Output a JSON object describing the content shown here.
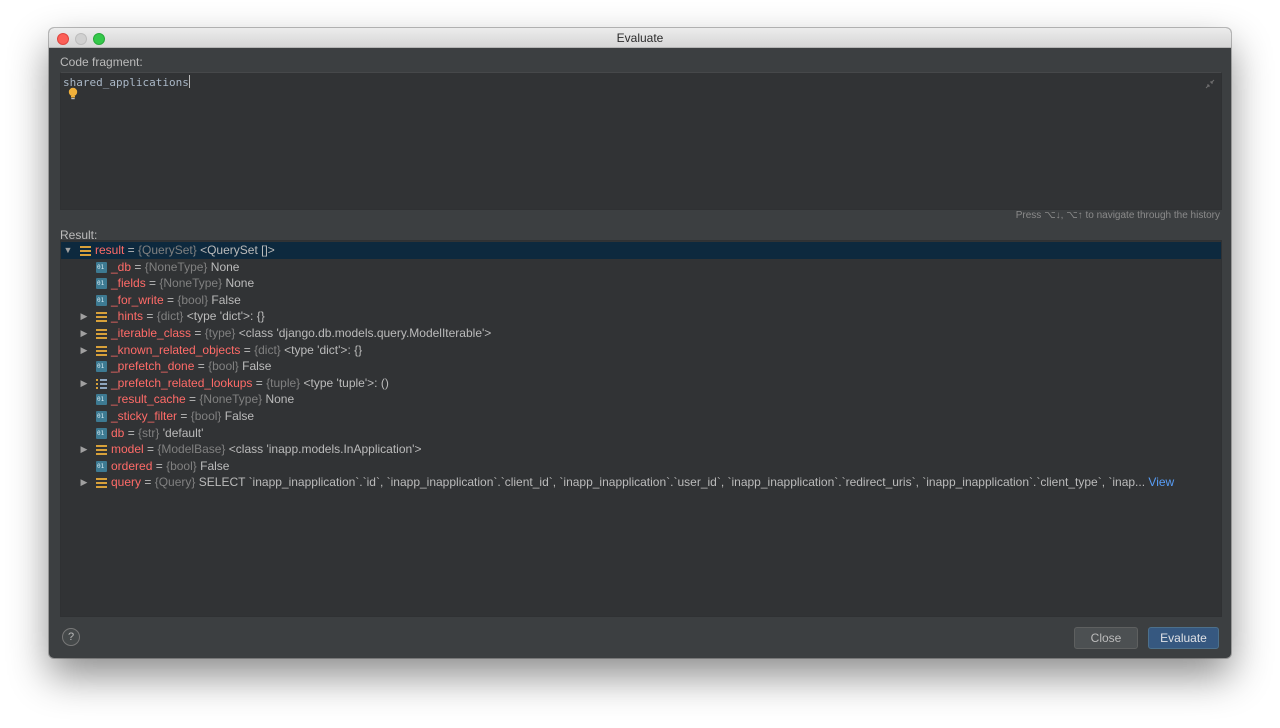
{
  "window": {
    "title": "Evaluate"
  },
  "code_fragment": {
    "label": "Code fragment:",
    "text": "shared_applications"
  },
  "history_hint": "Press ⌥↓, ⌥↑ to navigate through the history",
  "result": {
    "label": "Result:",
    "rows": [
      {
        "name": "result",
        "type": "{QuerySet}",
        "value": "<QuerySet []>"
      },
      {
        "name": "_db",
        "type": "{NoneType}",
        "value": "None"
      },
      {
        "name": "_fields",
        "type": "{NoneType}",
        "value": "None"
      },
      {
        "name": "_for_write",
        "type": "{bool}",
        "value": "False"
      },
      {
        "name": "_hints",
        "type": "{dict}",
        "value": "<type 'dict'>: {}"
      },
      {
        "name": "_iterable_class",
        "type": "{type}",
        "value": "<class 'django.db.models.query.ModelIterable'>"
      },
      {
        "name": "_known_related_objects",
        "type": "{dict}",
        "value": "<type 'dict'>: {}"
      },
      {
        "name": "_prefetch_done",
        "type": "{bool}",
        "value": "False"
      },
      {
        "name": "_prefetch_related_lookups",
        "type": "{tuple}",
        "value": "<type 'tuple'>: ()"
      },
      {
        "name": "_result_cache",
        "type": "{NoneType}",
        "value": "None"
      },
      {
        "name": "_sticky_filter",
        "type": "{bool}",
        "value": "False"
      },
      {
        "name": "db",
        "type": "{str}",
        "value": "'default'"
      },
      {
        "name": "model",
        "type": "{ModelBase}",
        "value": "<class 'inapp.models.InApplication'>"
      },
      {
        "name": "ordered",
        "type": "{bool}",
        "value": "False"
      },
      {
        "name": "query",
        "type": "{Query}",
        "value": "SELECT `inapp_inapplication`.`id`, `inapp_inapplication`.`client_id`, `inapp_inapplication`.`user_id`, `inapp_inapplication`.`redirect_uris`, `inapp_inapplication`.`client_type`, `inap",
        "ellipsis": "...",
        "link": "View"
      }
    ]
  },
  "buttons": {
    "help": "?",
    "close": "Close",
    "evaluate": "Evaluate"
  },
  "icons": {
    "row_icons": [
      "object-icon",
      "primitive-icon",
      "primitive-icon",
      "primitive-icon",
      "object-icon",
      "object-icon",
      "object-icon",
      "primitive-icon",
      "list-icon",
      "primitive-icon",
      "primitive-icon",
      "primitive-icon",
      "object-icon",
      "primitive-icon",
      "object-icon"
    ]
  },
  "colors": {
    "background": "#3c3f41",
    "name": "#ff6b68",
    "type": "#808080",
    "selected_row": "#0d293e",
    "primary_button": "#365880",
    "link": "#589df6"
  }
}
